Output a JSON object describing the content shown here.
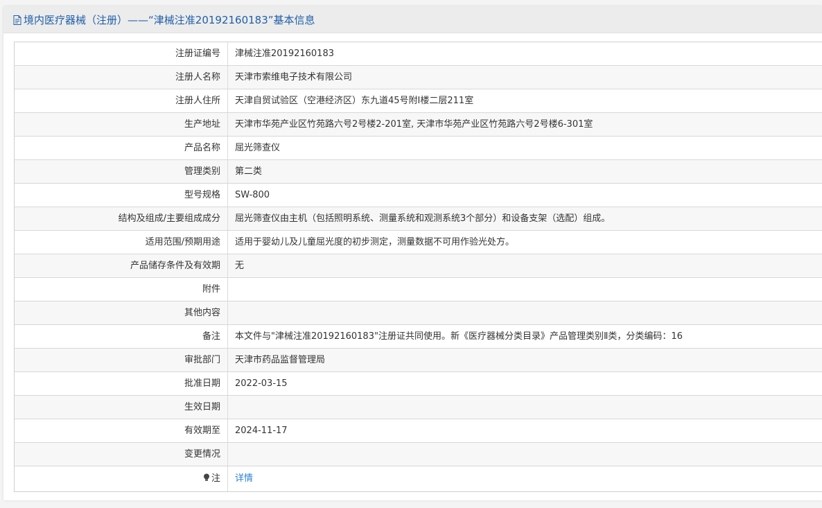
{
  "header": {
    "icon": "document-icon",
    "title": "境内医疗器械（注册）——“津械注准20192160183”基本信息"
  },
  "rows": [
    {
      "label": "注册证编号",
      "value": "津械注准20192160183"
    },
    {
      "label": "注册人名称",
      "value": "天津市索维电子技术有限公司"
    },
    {
      "label": "注册人住所",
      "value": "天津自贸试验区（空港经济区）东九道45号附Ⅰ楼二层211室"
    },
    {
      "label": "生产地址",
      "value": "天津市华苑产业区竹苑路六号2号楼2-201室, 天津市华苑产业区竹苑路六号2号楼6-301室"
    },
    {
      "label": "产品名称",
      "value": "屈光筛查仪"
    },
    {
      "label": "管理类别",
      "value": "第二类"
    },
    {
      "label": "型号规格",
      "value": "SW-800"
    },
    {
      "label": "结构及组成/主要组成成分",
      "value": "屈光筛查仪由主机（包括照明系统、测量系统和观测系统3个部分）和设备支架（选配）组成。"
    },
    {
      "label": "适用范围/预期用途",
      "value": "适用于婴幼儿及儿童屈光度的初步测定，测量数据不可用作验光处方。"
    },
    {
      "label": "产品储存条件及有效期",
      "value": "无"
    },
    {
      "label": "附件",
      "value": ""
    },
    {
      "label": "其他内容",
      "value": ""
    },
    {
      "label": "备注",
      "value": "本文件与\"津械注准20192160183\"注册证共同使用。新《医疗器械分类目录》产品管理类别Ⅱ类，分类编码：16"
    },
    {
      "label": "审批部门",
      "value": "天津市药品监督管理局"
    },
    {
      "label": "批准日期",
      "value": "2022-03-15"
    },
    {
      "label": "生效日期",
      "value": ""
    },
    {
      "label": "有效期至",
      "value": "2024-11-17"
    },
    {
      "label": "变更情况",
      "value": ""
    }
  ],
  "note_row": {
    "icon": "lightbulb-icon",
    "label": "注",
    "link_text": "详情"
  },
  "colors": {
    "header_text": "#1f5fa8",
    "link": "#2a7fd6"
  }
}
